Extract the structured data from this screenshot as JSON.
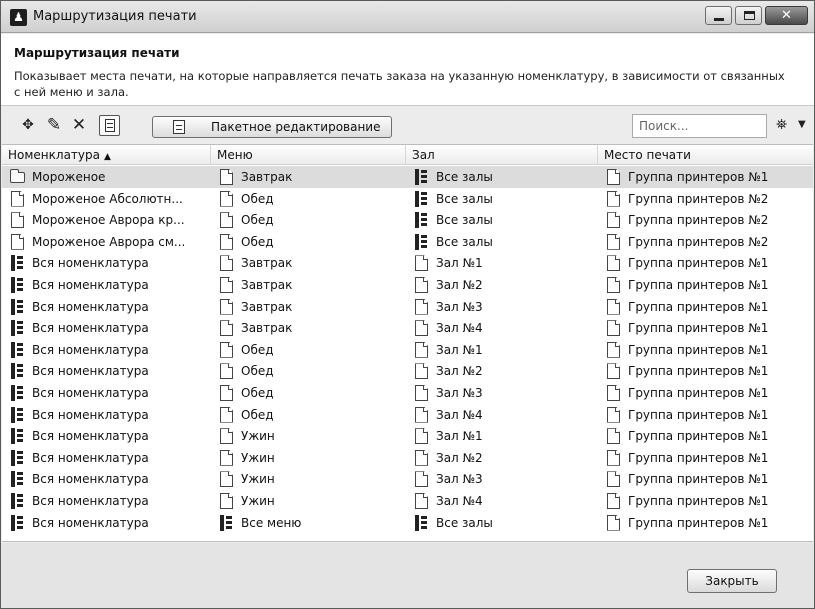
{
  "window": {
    "title": "Маршрутизация печати",
    "close_glyph": "✕"
  },
  "header": {
    "heading": "Маршрутизация печати",
    "description": "Показывает места печати, на которые направляется печать заказа на указанную номенклатуру, в зависимости от связанных с ней меню и зала."
  },
  "toolbar": {
    "add_glyph": "✥",
    "edit_glyph": "✎",
    "delete_glyph": "✕",
    "batch_edit_label": "Пакетное редактирование",
    "search_placeholder": "Поиск...",
    "binoculars_glyph": "⛯",
    "dropdown_glyph": "▼"
  },
  "grid": {
    "columns": [
      "Номенклатура",
      "Меню",
      "Зал",
      "Место печати"
    ],
    "sort_glyph": "▲",
    "rows": [
      {
        "item": "Мороженое",
        "item_icon": "folder",
        "menu": "Завтрак",
        "menu_icon": "doc",
        "hall": "Все залы",
        "hall_icon": "tree",
        "place": "Группа принтеров №1"
      },
      {
        "item": "Мороженое Абсолютн...",
        "item_icon": "doc",
        "menu": "Обед",
        "menu_icon": "doc",
        "hall": "Все залы",
        "hall_icon": "tree",
        "place": "Группа принтеров №2"
      },
      {
        "item": "Мороженое Аврора кр...",
        "item_icon": "doc",
        "menu": "Обед",
        "menu_icon": "doc",
        "hall": "Все залы",
        "hall_icon": "tree",
        "place": "Группа принтеров №2"
      },
      {
        "item": "Мороженое Аврора см...",
        "item_icon": "doc",
        "menu": "Обед",
        "menu_icon": "doc",
        "hall": "Все залы",
        "hall_icon": "tree",
        "place": "Группа принтеров №2"
      },
      {
        "item": "Вся номенклатура",
        "item_icon": "tree",
        "menu": "Завтрак",
        "menu_icon": "doc",
        "hall": "Зал №1",
        "hall_icon": "doc",
        "place": "Группа принтеров №1"
      },
      {
        "item": "Вся номенклатура",
        "item_icon": "tree",
        "menu": "Завтрак",
        "menu_icon": "doc",
        "hall": "Зал №2",
        "hall_icon": "doc",
        "place": "Группа принтеров №1"
      },
      {
        "item": "Вся номенклатура",
        "item_icon": "tree",
        "menu": "Завтрак",
        "menu_icon": "doc",
        "hall": "Зал №3",
        "hall_icon": "doc",
        "place": "Группа принтеров №1"
      },
      {
        "item": "Вся номенклатура",
        "item_icon": "tree",
        "menu": "Завтрак",
        "menu_icon": "doc",
        "hall": "Зал №4",
        "hall_icon": "doc",
        "place": "Группа принтеров №1"
      },
      {
        "item": "Вся номенклатура",
        "item_icon": "tree",
        "menu": "Обед",
        "menu_icon": "doc",
        "hall": "Зал №1",
        "hall_icon": "doc",
        "place": "Группа принтеров №1"
      },
      {
        "item": "Вся номенклатура",
        "item_icon": "tree",
        "menu": "Обед",
        "menu_icon": "doc",
        "hall": "Зал №2",
        "hall_icon": "doc",
        "place": "Группа принтеров №1"
      },
      {
        "item": "Вся номенклатура",
        "item_icon": "tree",
        "menu": "Обед",
        "menu_icon": "doc",
        "hall": "Зал №3",
        "hall_icon": "doc",
        "place": "Группа принтеров №1"
      },
      {
        "item": "Вся номенклатура",
        "item_icon": "tree",
        "menu": "Обед",
        "menu_icon": "doc",
        "hall": "Зал №4",
        "hall_icon": "doc",
        "place": "Группа принтеров №1"
      },
      {
        "item": "Вся номенклатура",
        "item_icon": "tree",
        "menu": "Ужин",
        "menu_icon": "doc",
        "hall": "Зал №1",
        "hall_icon": "doc",
        "place": "Группа принтеров №1"
      },
      {
        "item": "Вся номенклатура",
        "item_icon": "tree",
        "menu": "Ужин",
        "menu_icon": "doc",
        "hall": "Зал №2",
        "hall_icon": "doc",
        "place": "Группа принтеров №1"
      },
      {
        "item": "Вся номенклатура",
        "item_icon": "tree",
        "menu": "Ужин",
        "menu_icon": "doc",
        "hall": "Зал №3",
        "hall_icon": "doc",
        "place": "Группа принтеров №1"
      },
      {
        "item": "Вся номенклатура",
        "item_icon": "tree",
        "menu": "Ужин",
        "menu_icon": "doc",
        "hall": "Зал №4",
        "hall_icon": "doc",
        "place": "Группа принтеров №1"
      },
      {
        "item": "Вся номенклатура",
        "item_icon": "tree",
        "menu": "Все меню",
        "menu_icon": "tree",
        "hall": "Все залы",
        "hall_icon": "tree",
        "place": "Группа принтеров №1"
      }
    ]
  },
  "footer": {
    "close_label": "Закрыть"
  }
}
